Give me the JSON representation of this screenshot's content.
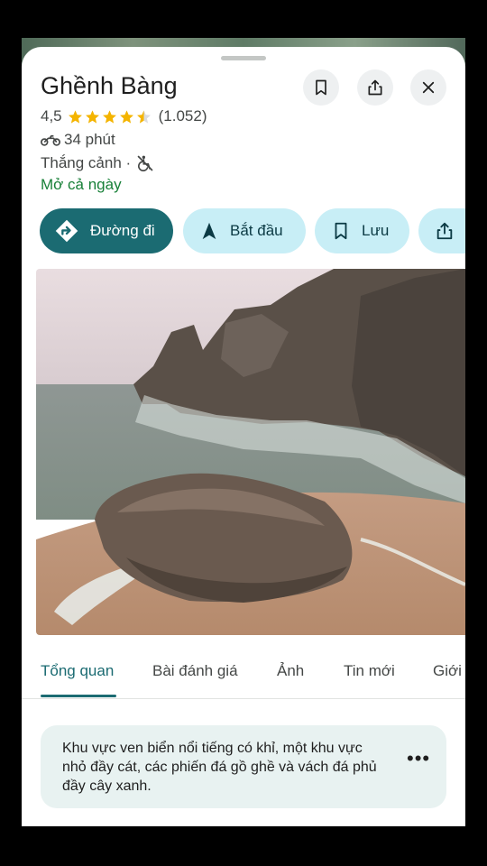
{
  "place": {
    "name": "Ghềnh Bàng",
    "rating": "4,5",
    "stars_value": 4.5,
    "review_count": "(1.052)",
    "travel_time": "34 phút",
    "category": "Thắng cảnh ·",
    "hours": "Mở cả ngày"
  },
  "header_buttons": {
    "save": "bookmark-icon",
    "share": "share-icon",
    "close": "close-icon"
  },
  "actions": [
    {
      "label": "Đường đi",
      "icon": "directions-icon"
    },
    {
      "label": "Bắt đầu",
      "icon": "navigation-arrow-icon"
    },
    {
      "label": "Lưu",
      "icon": "bookmark-icon"
    },
    {
      "label": "",
      "icon": "share-icon"
    }
  ],
  "tabs": [
    {
      "label": "Tổng quan"
    },
    {
      "label": "Bài đánh giá"
    },
    {
      "label": "Ảnh"
    },
    {
      "label": "Tin mới"
    },
    {
      "label": "Giới"
    }
  ],
  "description": "Khu vực ven biển nổi tiếng có khỉ, một khu vực nhỏ đầy cát, các phiến đá gồ ghề và vách đá phủ đầy cây xanh.",
  "colors": {
    "accent": "#1b6b72",
    "chip": "#c8eef6",
    "open_green": "#188038",
    "star": "#f4b400"
  }
}
